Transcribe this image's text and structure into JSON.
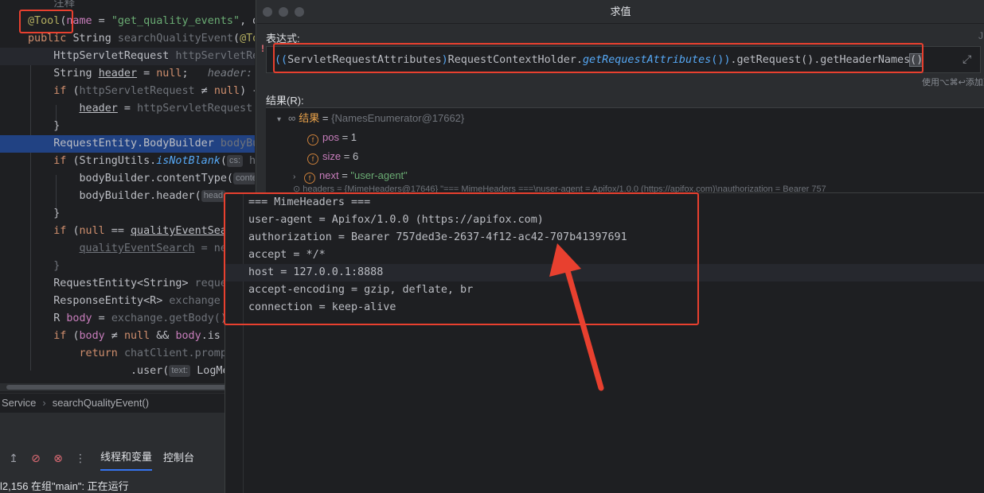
{
  "editor": {
    "lines": [
      {
        "html": "<span class=\"gr\">    注释</span>"
      },
      {
        "html": "<span class=\"an\">@Tool</span><span class=\"pl\">(</span><span class=\"fi\">name</span><span class=\"pl\"> = </span><span class=\"st\">\"get_quality_events\"</span><span class=\"pl\">, de</span>"
      },
      {
        "html": "<span class=\"kw\">public </span><span class=\"pl\">String </span><span class=\"gr\">searchQualityEvent</span><span class=\"pl\">(</span><span class=\"an\">@Too</span>"
      },
      {
        "html": "    <span class=\"pl\">HttpServletRequest </span><span class=\"gr\">httpServletReq</span>"
      },
      {
        "html": "    <span class=\"pl\">String </span><span class=\"pl u\">header</span><span class=\"pl\"> = </span><span class=\"kw\">null</span><span class=\"pl\">;   </span><span class=\"cm\">header: \"</span>"
      },
      {
        "html": "    <span class=\"kw\">if </span><span class=\"pl\">(</span><span class=\"gr\">httpServletRequest</span><span class=\"pl\"> ≠ </span><span class=\"kw\">null</span><span class=\"pl\">) {</span>"
      },
      {
        "html": "        <span class=\"pl u\">header</span><span class=\"pl\"> = </span><span class=\"gr\">httpServletRequest.g</span>"
      },
      {
        "html": "    <span class=\"pl\">}</span>"
      },
      {
        "html": "    <span class=\"pl\">RequestEntity.BodyBuilder </span><span class=\"gr\">bodyBui</span>",
        "hl": true
      },
      {
        "html": "    <span class=\"kw\">if </span><span class=\"pl\">(StringUtils.</span><span class=\"it\">isNotBlank</span><span class=\"pl\">(</span><span class=\"hint\">cs:</span><span class=\"gr\"> he</span>"
      },
      {
        "html": "        <span class=\"pl\">bodyBuilder.contentType(</span><span class=\"hint\">conte</span>"
      },
      {
        "html": "        <span class=\"pl\">bodyBuilder.header(</span><span class=\"hint\">head</span>"
      },
      {
        "html": "    <span class=\"pl\">}</span>"
      },
      {
        "html": "    <span class=\"kw\">if </span><span class=\"pl\">(</span><span class=\"kw\">null</span><span class=\"pl\"> == </span><span class=\"pl u\">qualityEventSear</span>"
      },
      {
        "html": "        <span class=\"gr u\">qualityEventSearch</span><span class=\"gr\"> = new</span>"
      },
      {
        "html": "    <span class=\"gr\">}</span>"
      },
      {
        "html": "    <span class=\"pl\">RequestEntity&lt;String&gt; </span><span class=\"gr\">reques</span>"
      },
      {
        "html": "    <span class=\"pl\">ResponseEntity&lt;R&gt; </span><span class=\"gr\">exchange =</span>"
      },
      {
        "html": "    <span class=\"pl\">R </span><span class=\"fi\">body</span><span class=\"pl\"> = </span><span class=\"gr\">exchange.getBody()</span>"
      },
      {
        "html": "    <span class=\"kw\">if </span><span class=\"pl\">(</span><span class=\"fi\">body</span><span class=\"pl\"> ≠ </span><span class=\"kw\">null</span><span class=\"pl\"> &amp;&amp; </span><span class=\"fi\">body</span><span class=\"pl\">.is</span>"
      },
      {
        "html": "        <span class=\"kw\">return </span><span class=\"gr\">chatClient.prompt</span>"
      },
      {
        "html": "                <span class=\"pl\">.user(</span><span class=\"hint\">text:</span><span class=\"pl\"> LogMe</span>"
      }
    ],
    "breadcrumb": [
      "Service",
      "searchQualityEvent()"
    ],
    "debug_tabs": [
      "线程和变量",
      "控制台"
    ],
    "status": "l2,156 在组\"main\": 正在运行"
  },
  "dialog": {
    "title": "求值",
    "expression_label": "表达式:",
    "expression_right": "J",
    "expression": "((ServletRequestAttributes)RequestContextHolder.getRequestAttributes()).getRequest().getHeaderNames()",
    "hint": "使用⌥⌘↩添加到",
    "result_label": "结果(R):",
    "tree": {
      "root": {
        "name": "结果",
        "value": "{NamesEnumerator@17662}"
      },
      "children": [
        {
          "name": "pos",
          "value": "1"
        },
        {
          "name": "size",
          "value": "6"
        },
        {
          "name": "next",
          "value": "\"user-agent\""
        }
      ],
      "partial_row": "⊙ headers = {MimeHeaders@17646} \"=== MimeHeaders ===\\nuser-agent = Apifox/1.0.0 (https://apifox.com)\\nauthorization = Bearer 757"
    }
  },
  "popup": {
    "lines": [
      "=== MimeHeaders ===",
      "user-agent = Apifox/1.0.0 (https://apifox.com)",
      "authorization = Bearer 757ded3e-2637-4f12-ac42-707b41397691",
      "accept = */*",
      "host = 127.0.0.1:8888",
      "accept-encoding = gzip, deflate, br",
      "connection = keep-alive"
    ]
  },
  "annotation_color": "#e8402f"
}
